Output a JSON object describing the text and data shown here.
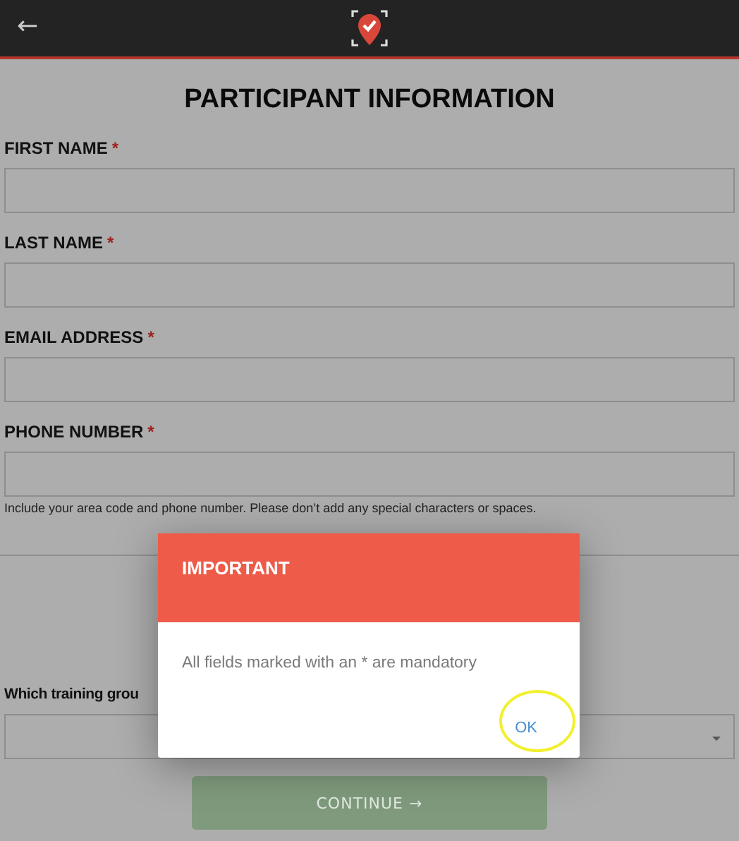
{
  "header": {
    "back": "←"
  },
  "title": "PARTICIPANT INFORMATION",
  "fields": [
    {
      "label": "FIRST NAME",
      "required_mark": "*"
    },
    {
      "label": "LAST NAME",
      "required_mark": "*"
    },
    {
      "label": "EMAIL ADDRESS",
      "required_mark": "*"
    },
    {
      "label": "PHONE NUMBER",
      "required_mark": "*",
      "help": "Include your area code and phone number. Please don’t add any special characters or spaces."
    }
  ],
  "group_question": {
    "label": "Which training grou"
  },
  "continue_button": {
    "label": "CONTINUE",
    "arrow": "→",
    "disabled": true
  },
  "dialog": {
    "title": "IMPORTANT",
    "message": "All fields marked with an * are mandatory",
    "button": "OK",
    "button_highlighted": true
  }
}
